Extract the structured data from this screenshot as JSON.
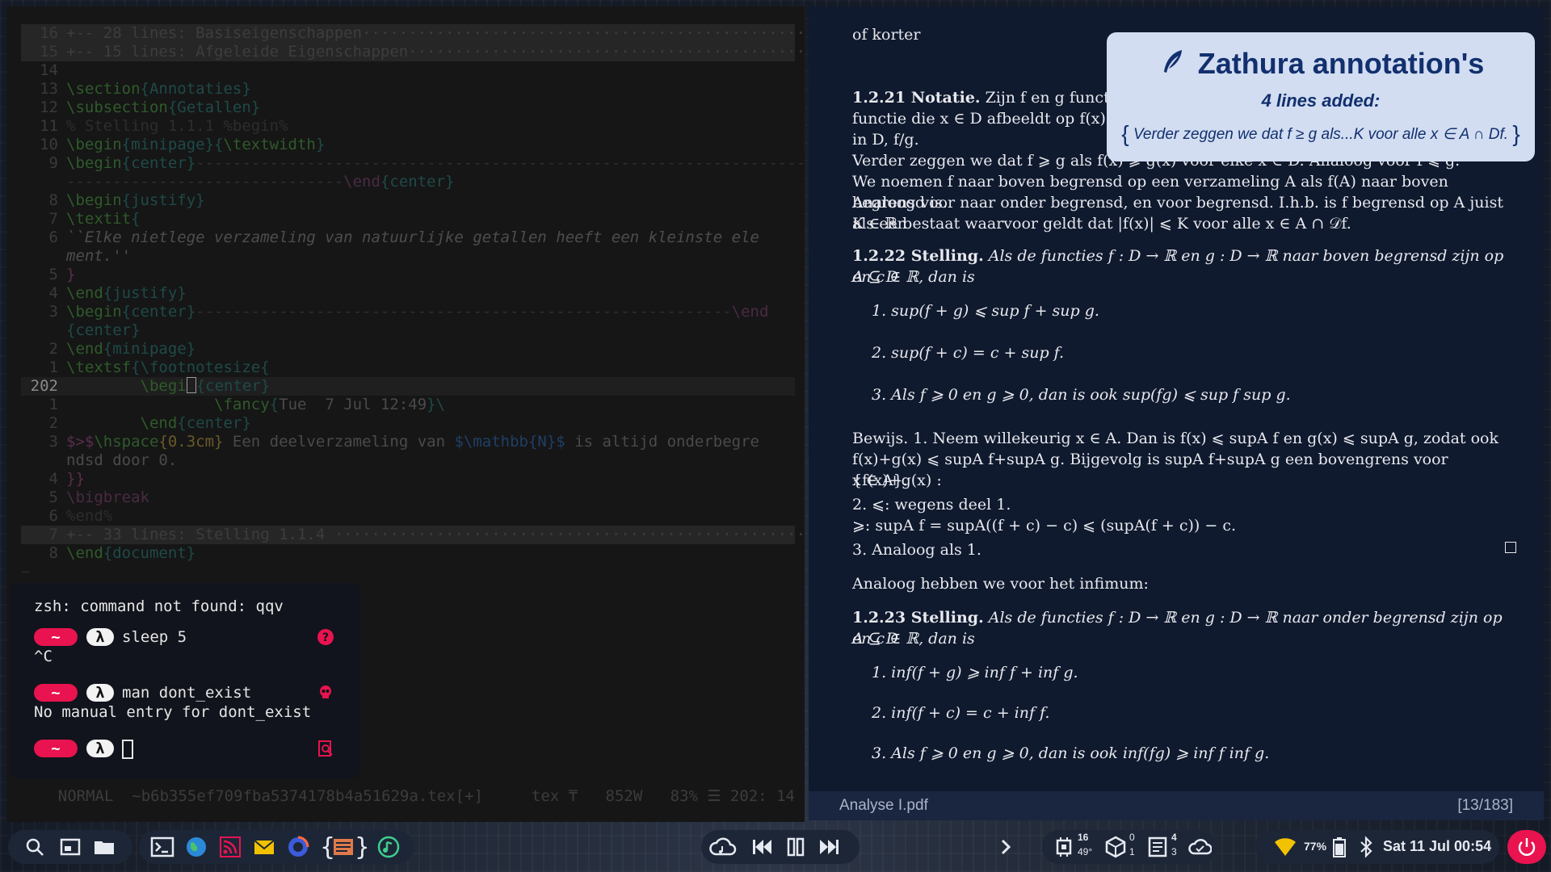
{
  "editor": {
    "lines": [
      {
        "num": "16",
        "kind": "fold",
        "text": "+-- 28 lines: Basiseigenschappen······························································"
      },
      {
        "num": "15",
        "kind": "fold",
        "text": "+-- 15 lines: Afgeleide Eigenschappen·························································"
      },
      {
        "num": "14",
        "kind": "blank",
        "text": ""
      },
      {
        "num": "13",
        "kind": "code",
        "cmd": "\\section",
        "arg": "Annotaties"
      },
      {
        "num": "12",
        "kind": "code",
        "cmd": "\\subsection",
        "arg": "Getallen"
      },
      {
        "num": "11",
        "kind": "comment",
        "text": "% Stelling 1.1.1 %begin%"
      },
      {
        "num": "10",
        "kind": "code2",
        "cmd": "\\begin",
        "arg": "minipage",
        "cmd2": "\\textwidth"
      },
      {
        "num": "9",
        "kind": "codedash",
        "cmd": "\\begin",
        "arg": "center",
        "dash": "-------------------------------------------------------------------------"
      },
      {
        "num": "",
        "kind": "dashend",
        "dash": "------------------------------",
        "cmd": "\\end",
        "arg": "center"
      },
      {
        "num": "8",
        "kind": "code",
        "cmd": "\\begin",
        "arg": "justify"
      },
      {
        "num": "7",
        "kind": "open",
        "cmd": "\\textit",
        "brace": "{"
      },
      {
        "num": "6",
        "kind": "italic",
        "text": "``Elke nietlege verzameling van natuurlijke getallen heeft een kleinste ele"
      },
      {
        "num": "",
        "kind": "italic",
        "text": "ment.''"
      },
      {
        "num": "5",
        "kind": "close",
        "text": "}"
      },
      {
        "num": "4",
        "kind": "code",
        "cmd": "\\end",
        "arg": "justify"
      },
      {
        "num": "3",
        "kind": "codedash2",
        "cmd": "\\begin",
        "arg": "center",
        "dash": "----------------------------------------------------------",
        "tail": "\\end"
      },
      {
        "num": "",
        "kind": "brace",
        "text": "{center}"
      },
      {
        "num": "2",
        "kind": "code",
        "cmd": "\\end",
        "arg": "minipage"
      },
      {
        "num": "1",
        "kind": "code3",
        "cmd": "\\textsf",
        "mid": "{\\footnotesize",
        "end": "{"
      },
      {
        "num": "202",
        "kind": "cursorline",
        "pre": "        \\begi",
        "post": "{center}"
      },
      {
        "num": "1",
        "kind": "fancy",
        "pre": "                ",
        "cmd": "\\fancy",
        "arg": "Tue  7 Jul 12:49",
        "tail": "}\\"
      },
      {
        "num": "2",
        "kind": "code",
        "indent": "        ",
        "cmd": "\\end",
        "arg": "center"
      },
      {
        "num": "3",
        "kind": "math",
        "text1": "$>$",
        "cmd": "\\hspace",
        "arg": "0.3cm",
        "text2": " Een deelverzameling van ",
        "math": "$\\mathbb{N}$",
        "text3": " is altijd onderbegre"
      },
      {
        "num": "",
        "kind": "plain",
        "text": "ndsd door 0."
      },
      {
        "num": "4",
        "kind": "close",
        "text": "}}"
      },
      {
        "num": "5",
        "kind": "cmdonly",
        "cmd": "\\bigbreak"
      },
      {
        "num": "6",
        "kind": "comment",
        "text": "%end%"
      },
      {
        "num": "7",
        "kind": "fold",
        "text": "+-- 33 lines: Stelling 1.1.4 ······························································"
      },
      {
        "num": "8",
        "kind": "code",
        "cmd": "\\end",
        "arg": "document"
      }
    ],
    "status": {
      "mode": "NORMAL",
      "file": "~b6b355ef709fba5374178b4a51629a.tex[+]",
      "filetype": "tex",
      "words": "852W",
      "percent": "83%",
      "position": "202: 14"
    }
  },
  "terminal": {
    "error_line": "zsh: command not found: qqv",
    "prompt_tilde": "~",
    "prompt_lambda": "λ",
    "cmd1": "sleep 5",
    "out1": "^C",
    "cmd2": "man dont_exist",
    "out2": "No manual entry for dont_exist",
    "icons": [
      "question-icon",
      "skull-icon",
      "search-doc-icon"
    ]
  },
  "pdf": {
    "top_text": "of korter",
    "n121_label": "1.2.21 Notatie.",
    "n121_l1": "Zijn f en g functies dan noteren we f + g, f − g, fg voor de",
    "n121_l2": "functie die x ∈ D afbeeldt op f(x) + g(x), f(x) − g(x), f(x)g(x) enzovoort. Analoog",
    "n121_l3": "in D, f/g.",
    "n121_l4": "Verder zeggen we dat f ⩾ g als f(x) ⩾ g(x) voor elke x ∈ D. Analoog voor f ⩽ g.",
    "n121_l5": "We noemen f naar boven begrensd op een verzameling A als f(A) naar boven begrensd is.",
    "n121_l6": "Analoog voor naar onder begrensd, en voor begrensd. I.h.b. is f begrensd op A juist als een",
    "n121_l7": "K ∈ ℝ bestaat waarvoor geldt dat |f(x)| ⩽ K voor alle x ∈ A ∩ 𝒟f.",
    "s122_label": "1.2.22 Stelling.",
    "s122_l1": "Als de functies f : D → ℝ en g : D → ℝ naar boven begrensd zijn op A ⊆ D",
    "s122_l2": "en c ∈ ℝ, dan is",
    "s122_items": [
      "1.  sup(f + g) ⩽ sup f + sup g.",
      "2.  sup(f + c) = c + sup f.",
      "3.  Als f ⩾ 0 en g ⩾ 0, dan is ook sup(fg) ⩽ sup f sup g."
    ],
    "sub_A": "A",
    "proof_l1": "Bewijs. 1.  Neem willekeurig x ∈ A.  Dan is f(x) ⩽ supA f en g(x) ⩽ supA g, zodat ook",
    "proof_l2": "f(x)+g(x) ⩽ supA f+supA g. Bijgevolg is supA f+supA g een bovengrens voor {f(x)+g(x) :",
    "proof_l3": "x ∈ A}.",
    "proof_l4": "2. ⩽: wegens deel 1.",
    "proof_l5": "⩾: supA f = supA((f + c) − c) ⩽ (supA(f + c)) − c.",
    "proof_l6": "3.  Analoog als 1.",
    "inf_intro": "Analoog hebben we voor het infimum:",
    "s123_label": "1.2.23 Stelling.",
    "s123_l1": "Als de functies f : D → ℝ en g : D → ℝ naar onder begrensd zijn op A ⊆ D",
    "s123_l2": "en c ∈ ℝ, dan is",
    "s123_items": [
      "1.  inf(f + g) ⩾ inf f + inf g.",
      "2.  inf(f + c) = c + inf f.",
      "3.  Als f ⩾ 0 en g ⩾ 0, dan is ook  inf(fg) ⩾ inf f inf g."
    ],
    "filename": "Analyse I.pdf",
    "page": "[13/183]"
  },
  "notification": {
    "title": "Zathura annotation's",
    "subtitle": "4 lines added:",
    "body": "Verder zeggen we dat f ≥ g als...K voor alle x ∈ A ∩ Df.",
    "brace_open": "{",
    "brace_close": "}"
  },
  "taskbar": {
    "left_icons": [
      "search-icon",
      "screenshot-icon",
      "folder-icon"
    ],
    "app_icons": [
      "terminal-icon",
      "browser-icon",
      "rss-icon",
      "mail-icon",
      "firefox-icon",
      "code-editor-icon",
      "music-icon"
    ],
    "media_icons": [
      "cloud-music-icon",
      "previous-icon",
      "pause-icon",
      "next-icon"
    ],
    "cpu_top": "16",
    "cpu_bottom": "49°",
    "pkg_top": "0",
    "pkg_bottom": "1",
    "mem_top": "4",
    "mem_bottom": "3",
    "battery": "77%",
    "datetime": "Sat 11 Jul 00:54",
    "colors": {
      "accent": "#e8134f",
      "wifi": "#f2c200",
      "pill": "#1d2637"
    }
  }
}
